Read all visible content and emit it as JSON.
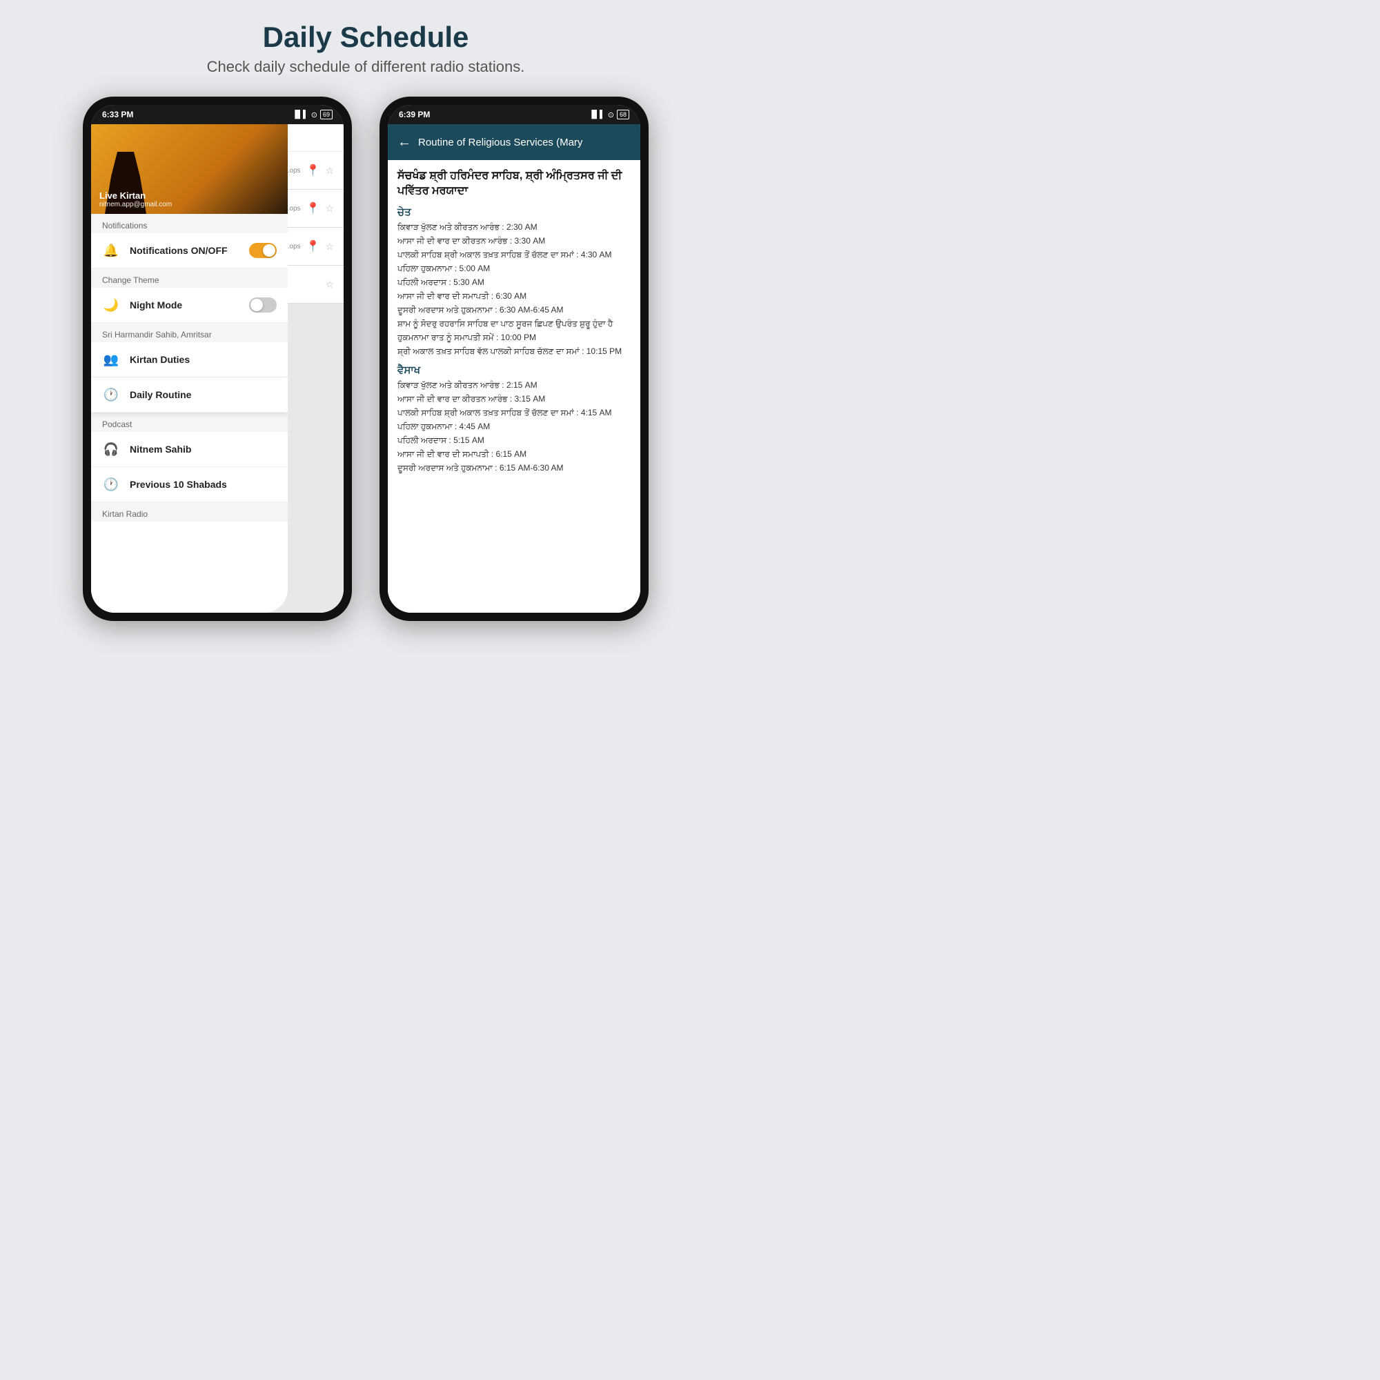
{
  "header": {
    "title": "Daily Schedule",
    "subtitle": "Check daily schedule of different radio stations."
  },
  "left_phone": {
    "time": "6:33 PM",
    "battery": "69",
    "hero": {
      "name": "Live Kirtan",
      "email": "nitnem.app@gmail.com"
    },
    "menu": {
      "notifications_label": "Notifications",
      "notifications_toggle_label": "Notifications ON/OFF",
      "change_theme_label": "Change Theme",
      "night_mode_label": "Night Mode",
      "harmandir_section": "Sri Harmandir Sahib, Amritsar",
      "kirtan_duties_label": "Kirtan Duties",
      "daily_routine_label": "Daily Routine",
      "podcast_section": "Podcast",
      "nitnem_sahib_label": "Nitnem Sahib",
      "previous_shabads_label": "Previous 10 Shabads",
      "kirtan_radio_section": "Kirtan Radio"
    },
    "map_items": [
      "ops",
      "ops",
      "ops"
    ]
  },
  "right_phone": {
    "time": "6:39 PM",
    "battery": "68",
    "app_bar_title": "Routine of Religious Services (Mary",
    "content_title": "ਸੱਚਖੰਡ ਸ਼੍ਰੀ ਹਰਿਮੰਦਰ ਸਾਹਿਬ, ਸ਼੍ਰੀ ਅੰਮ੍ਰਿਤਸਰ ਜੀ ਦੀ ਪਵਿੱਤਰ ਮਰਯਾਦਾ",
    "sections": [
      {
        "heading": "ਚੇਤ",
        "items": [
          "ਕਿਵਾੜ ਖੁੱਲਣ ਅਤੇ ਕੀਰਤਨ ਆਰੰਭ : 2:30 AM",
          "ਆਸਾ ਜੀ ਦੀ ਵਾਰ ਦਾ ਕੀਰਤਨ ਆਰੰਭ : 3:30 AM",
          "ਪਾਲਕੀ ਸਾਹਿਬ ਸ਼੍ਰੀ ਅਕਾਲ ਤਖ਼ਤ ਸਾਹਿਬ ਤੋਂ ਚੱਲਣ ਦਾ ਸਮਾਂ : 4:30 AM",
          "ਪਹਿਲਾ ਹੁਕਮਨਾਮਾ : 5:00 AM",
          "ਪਹਿਲੀ ਅਰਦਾਸ : 5:30 AM",
          "ਆਸਾ ਜੀ ਦੀ ਵਾਰ ਦੀ ਸਮਾਪਤੀ : 6:30 AM",
          "ਦੂਸਰੀ ਅਰਦਾਸ ਅਤੇ ਹੁਕਮਨਾਮਾ : 6:30 AM-6:45 AM",
          "ਸ਼ਾਮ ਨੂੰ ਸੋਦਰੁ ਰਹਰਾਸਿ ਸਾਹਿਬ ਦਾ ਪਾਠ ਸੂਰਜ ਛਿਪਣ ਉਪਰੰਤ ਸ਼ੁਰੂ ਹੁੰਦਾ ਹੈ",
          "ਹੁਕਮਨਾਮਾ ਰਾਤ ਨੂੰ ਸਮਾਪਤੀ ਸਮੇਂ : 10:00 PM",
          "ਸ਼੍ਰੀ ਅਕਾਲ ਤਖ਼ਤ ਸਾਹਿਬ ਵੱਲ ਪਾਲਕੀ ਸਾਹਿਬ ਚੱਲਣ ਦਾ ਸਮਾਂ : 10:15 PM"
        ]
      },
      {
        "heading": "ਵੈਸਾਖ",
        "items": [
          "ਕਿਵਾੜ ਖੁੱਲਣ ਅਤੇ ਕੀਰਤਨ ਆਰੰਭ : 2:15 AM",
          "ਆਸਾ ਜੀ ਦੀ ਵਾਰ ਦਾ ਕੀਰਤਨ ਆਰੰਭ : 3:15 AM",
          "ਪਾਲਕੀ ਸਾਹਿਬ ਸ਼੍ਰੀ ਅਕਾਲ ਤਖ਼ਤ ਸਾਹਿਬ ਤੋਂ ਚੱਲਣ ਦਾ ਸਮਾਂ : 4:15 AM",
          "ਪਹਿਲਾ ਹੁਕਮਨਾਮਾ : 4:45 AM",
          "ਪਹਿਲੀ ਅਰਦਾਸ : 5:15 AM",
          "ਆਸਾ ਜੀ ਦੀ ਵਾਰ ਦੀ ਸਮਾਪਤੀ : 6:15 AM",
          "ਦੂਸਰੀ ਅਰਦਾਸ ਅਤੇ ਹੁਕਮਨਾਮਾ : 6:15 AM-6:30 AM"
        ]
      }
    ]
  }
}
